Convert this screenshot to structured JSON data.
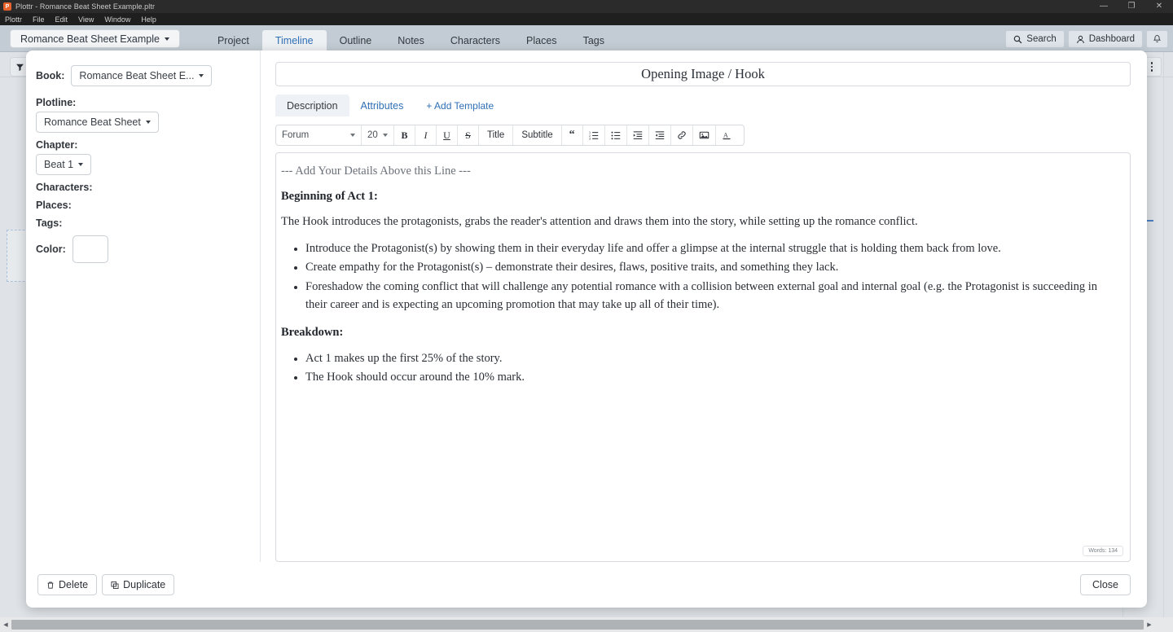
{
  "window": {
    "title": "Plottr - Romance Beat Sheet Example.pltr",
    "logo_letter": "P",
    "controls": [
      {
        "name": "minimize",
        "glyph": "—"
      },
      {
        "name": "maximize",
        "glyph": "❐"
      },
      {
        "name": "close",
        "glyph": "✕"
      }
    ]
  },
  "menubar": {
    "items": [
      "Plottr",
      "File",
      "Edit",
      "View",
      "Window",
      "Help"
    ]
  },
  "navbar": {
    "book_selector": "Romance Beat Sheet Example",
    "tabs": [
      {
        "label": "Project",
        "active": false
      },
      {
        "label": "Timeline",
        "active": true
      },
      {
        "label": "Outline",
        "active": false
      },
      {
        "label": "Notes",
        "active": false
      },
      {
        "label": "Characters",
        "active": false
      },
      {
        "label": "Places",
        "active": false
      },
      {
        "label": "Tags",
        "active": false
      }
    ],
    "search_label": "Search",
    "dashboard_label": "Dashboard",
    "notification_icon": "bell-icon"
  },
  "modal": {
    "title_value": "Opening Image / Hook",
    "meta": {
      "book_label": "Book:",
      "book_value": "Romance Beat Sheet E...",
      "plotline_label": "Plotline:",
      "plotline_value": "Romance Beat Sheet",
      "chapter_label": "Chapter:",
      "chapter_value": "Beat 1",
      "characters_label": "Characters:",
      "places_label": "Places:",
      "tags_label": "Tags:",
      "color_label": "Color:",
      "color_value": "#ffffff"
    },
    "tabs": [
      {
        "label": "Description",
        "active": true
      },
      {
        "label": "Attributes",
        "active": false
      },
      {
        "label": "+ Add Template",
        "active": false
      }
    ],
    "toolbar": {
      "font_family": "Forum",
      "font_size": "20",
      "bold": "B",
      "italic": "I",
      "underline": "U",
      "strikethrough": "S",
      "title": "Title",
      "subtitle": "Subtitle",
      "blockquote": "“",
      "ordered_list": "ordered-list-icon",
      "bullet_list": "bullet-list-icon",
      "indent": "indent-icon",
      "outdent": "outdent-icon",
      "link": "link-icon",
      "image": "image-icon",
      "text_color": "text-color-icon"
    },
    "editor": {
      "placeholder_line": "--- Add Your Details Above this Line ---",
      "heading_1": "Beginning of Act 1:",
      "paragraph_1": "The Hook introduces the protagonists, grabs the reader's attention and draws them into the story, while setting up the romance conflict.",
      "bullets_1": [
        "Introduce the Protagonist(s) by showing them in their everyday life and offer a glimpse at the internal struggle that is holding them back from love.",
        "Create empathy for the Protagonist(s) – demonstrate their desires, flaws, positive traits, and something they lack.",
        "Foreshadow the coming conflict that will challenge any potential romance with a collision between external goal and internal goal (e.g. the Protagonist is succeeding in their career and is expecting an upcoming promotion that may take up all of their time)."
      ],
      "heading_2": "Breakdown:",
      "bullets_2": [
        "Act 1 makes up the first 25% of the story.",
        "The Hook should occur around the 10% mark."
      ],
      "word_count": "Words: 134"
    },
    "footer": {
      "delete_label": "Delete",
      "duplicate_label": "Duplicate",
      "close_label": "Close"
    }
  },
  "workspace": {
    "filter_icon": "filter-icon",
    "menu_icon": "kebab-menu-icon"
  }
}
